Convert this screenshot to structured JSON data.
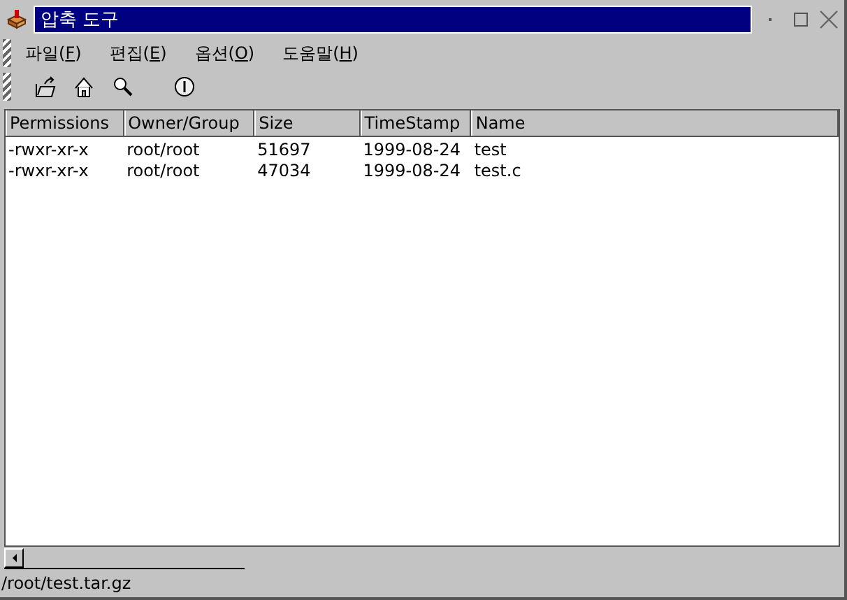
{
  "window": {
    "title": "압축 도구"
  },
  "menu": [
    {
      "before": "파일(",
      "mnemonic": "F",
      "after": ")"
    },
    {
      "before": "편집(",
      "mnemonic": "E",
      "after": ")"
    },
    {
      "before": "옵션(",
      "mnemonic": "O",
      "after": ")"
    },
    {
      "before": "도움말(",
      "mnemonic": "H",
      "after": ")"
    }
  ],
  "toolbar": [
    {
      "kind": "open"
    },
    {
      "kind": "home"
    },
    {
      "kind": "search"
    },
    {
      "kind": "info"
    }
  ],
  "table": {
    "columns": [
      "Permissions",
      "Owner/Group",
      "Size",
      "TimeStamp",
      "Name"
    ],
    "rows": [
      [
        "-rwxr-xr-x",
        "root/root",
        "51697",
        "1999-08-24",
        "test"
      ],
      [
        "-rwxr-xr-x",
        "root/root",
        "47034",
        "1999-08-24",
        "test.c"
      ]
    ]
  },
  "status_bar": "/root/test.tar.gz"
}
